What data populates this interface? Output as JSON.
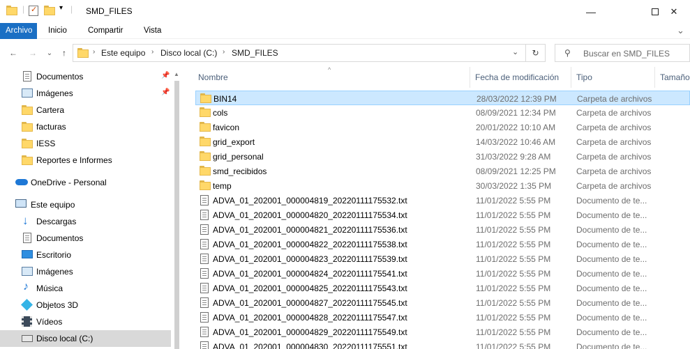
{
  "window": {
    "title": "SMD_FILES",
    "minimize": "—",
    "maximize": "☐",
    "close": "✕"
  },
  "ribbon": {
    "tabs": [
      "Archivo",
      "Inicio",
      "Compartir",
      "Vista"
    ],
    "expand": "⌄"
  },
  "nav": {
    "back": "←",
    "forward": "→",
    "recent": "⌄",
    "up": "↑"
  },
  "address": {
    "crumbs": [
      "Este equipo",
      "Disco local (C:)",
      "SMD_FILES"
    ],
    "dropdown": "⌄",
    "refresh": "↻"
  },
  "search": {
    "placeholder": "Buscar en SMD_FILES"
  },
  "sidebar": {
    "items": [
      {
        "label": "Documentos",
        "icon": "documents-icon",
        "pinned": true
      },
      {
        "label": "Imágenes",
        "icon": "pictures-icon",
        "pinned": true
      },
      {
        "label": "Cartera",
        "icon": "folder-icon",
        "pinned": false
      },
      {
        "label": "facturas",
        "icon": "folder-icon",
        "pinned": false
      },
      {
        "label": "IESS",
        "icon": "folder-icon",
        "pinned": false
      },
      {
        "label": "Reportes e Informes",
        "icon": "folder-icon",
        "pinned": false
      },
      {
        "label": "OneDrive - Personal",
        "icon": "onedrive-icon",
        "pinned": false
      },
      {
        "label": "Este equipo",
        "icon": "this-pc-icon",
        "pinned": false
      },
      {
        "label": "Descargas",
        "icon": "downloads-icon",
        "pinned": false
      },
      {
        "label": "Documentos",
        "icon": "documents-icon",
        "pinned": false
      },
      {
        "label": "Escritorio",
        "icon": "desktop-icon",
        "pinned": false
      },
      {
        "label": "Imágenes",
        "icon": "pictures-icon",
        "pinned": false
      },
      {
        "label": "Música",
        "icon": "music-icon",
        "pinned": false
      },
      {
        "label": "Objetos 3D",
        "icon": "objects-3d-icon",
        "pinned": false
      },
      {
        "label": "Vídeos",
        "icon": "videos-icon",
        "pinned": false
      },
      {
        "label": "Disco local (C:)",
        "icon": "drive-icon",
        "pinned": false
      }
    ]
  },
  "columns": {
    "name": "Nombre",
    "date": "Fecha de modificación",
    "type": "Tipo",
    "size": "Tamaño"
  },
  "files": [
    {
      "name": "BIN14",
      "date": "28/03/2022 12:39 PM",
      "type": "Carpeta de archivos",
      "kind": "folder",
      "selected": true
    },
    {
      "name": "cols",
      "date": "08/09/2021 12:34 PM",
      "type": "Carpeta de archivos",
      "kind": "folder"
    },
    {
      "name": "favicon",
      "date": "20/01/2022 10:10 AM",
      "type": "Carpeta de archivos",
      "kind": "folder"
    },
    {
      "name": "grid_export",
      "date": "14/03/2022 10:46 AM",
      "type": "Carpeta de archivos",
      "kind": "folder"
    },
    {
      "name": "grid_personal",
      "date": "31/03/2022 9:28 AM",
      "type": "Carpeta de archivos",
      "kind": "folder"
    },
    {
      "name": "smd_recibidos",
      "date": "08/09/2021 12:25 PM",
      "type": "Carpeta de archivos",
      "kind": "folder"
    },
    {
      "name": "temp",
      "date": "30/03/2022 1:35 PM",
      "type": "Carpeta de archivos",
      "kind": "folder"
    },
    {
      "name": "ADVA_01_202001_000004819_20220111175532.txt",
      "date": "11/01/2022 5:55 PM",
      "type": "Documento de te...",
      "kind": "text"
    },
    {
      "name": "ADVA_01_202001_000004820_20220111175534.txt",
      "date": "11/01/2022 5:55 PM",
      "type": "Documento de te...",
      "kind": "text"
    },
    {
      "name": "ADVA_01_202001_000004821_20220111175536.txt",
      "date": "11/01/2022 5:55 PM",
      "type": "Documento de te...",
      "kind": "text"
    },
    {
      "name": "ADVA_01_202001_000004822_20220111175538.txt",
      "date": "11/01/2022 5:55 PM",
      "type": "Documento de te...",
      "kind": "text"
    },
    {
      "name": "ADVA_01_202001_000004823_20220111175539.txt",
      "date": "11/01/2022 5:55 PM",
      "type": "Documento de te...",
      "kind": "text"
    },
    {
      "name": "ADVA_01_202001_000004824_20220111175541.txt",
      "date": "11/01/2022 5:55 PM",
      "type": "Documento de te...",
      "kind": "text"
    },
    {
      "name": "ADVA_01_202001_000004825_20220111175543.txt",
      "date": "11/01/2022 5:55 PM",
      "type": "Documento de te...",
      "kind": "text"
    },
    {
      "name": "ADVA_01_202001_000004827_20220111175545.txt",
      "date": "11/01/2022 5:55 PM",
      "type": "Documento de te...",
      "kind": "text"
    },
    {
      "name": "ADVA_01_202001_000004828_20220111175547.txt",
      "date": "11/01/2022 5:55 PM",
      "type": "Documento de te...",
      "kind": "text"
    },
    {
      "name": "ADVA_01_202001_000004829_20220111175549.txt",
      "date": "11/01/2022 5:55 PM",
      "type": "Documento de te...",
      "kind": "text"
    },
    {
      "name": "ADVA_01_202001_000004830_20220111175551.txt",
      "date": "11/01/2022 5:55 PM",
      "type": "Documento de te...",
      "kind": "text"
    }
  ],
  "colors": {
    "accent": "#1a6fc4",
    "selection": "#cce8ff",
    "folder": "#ffd869"
  }
}
